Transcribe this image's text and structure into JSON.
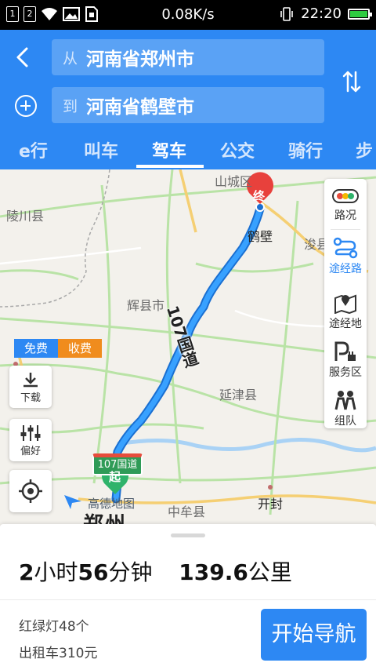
{
  "status_bar": {
    "sim1": "1",
    "sim2": "2",
    "speed": "0.08K/s",
    "time": "22:20"
  },
  "header": {
    "from_prefix": "从",
    "from_value": "河南省郑州市",
    "to_prefix": "到",
    "to_value": "河南省鹤壁市"
  },
  "tabs": [
    {
      "label": "e行"
    },
    {
      "label": "叫车"
    },
    {
      "label": "驾车",
      "active": true
    },
    {
      "label": "公交"
    },
    {
      "label": "骑行"
    },
    {
      "label": "步"
    }
  ],
  "map": {
    "labels": {
      "shancheng": "山城区",
      "lingchuan": "陵川县",
      "hebi": "鹤壁",
      "xunxian": "浚县",
      "huixian": "辉县市",
      "yanjin": "延津县",
      "zhongmou": "中牟县",
      "kaifeng": "开封",
      "zhengzhou": "郑州"
    },
    "road_name": "107国道",
    "route_sign": "107国道",
    "end_marker": "终",
    "start_marker": "起",
    "fee_free": "免费",
    "fee_toll": "收费",
    "logo": "高德地图",
    "right_panel": [
      {
        "label": "路况",
        "icon": "traffic-light-icon"
      },
      {
        "label": "途经路",
        "icon": "route-waypoint-icon",
        "active": true
      },
      {
        "label": "途经地",
        "icon": "map-place-icon"
      },
      {
        "label": "服务区",
        "icon": "service-area-icon"
      },
      {
        "label": "组队",
        "icon": "team-icon"
      }
    ],
    "left_buttons": {
      "download": "下载",
      "preference": "偏好"
    }
  },
  "summary": {
    "h_num": "2",
    "h_unit": "小时",
    "m_num": "56",
    "m_unit": "分钟",
    "dist_num": "139.6",
    "dist_unit": "公里",
    "traffic_lights": "红绿灯48个",
    "taxi_fare": "出租车310元",
    "start_nav": "开始导航"
  },
  "colors": {
    "brand_blue": "#2d88f3",
    "toll_orange": "#f08c1d",
    "route_blue": "#1f86f0",
    "end_red": "#e8413c",
    "start_green": "#2fb36b"
  }
}
